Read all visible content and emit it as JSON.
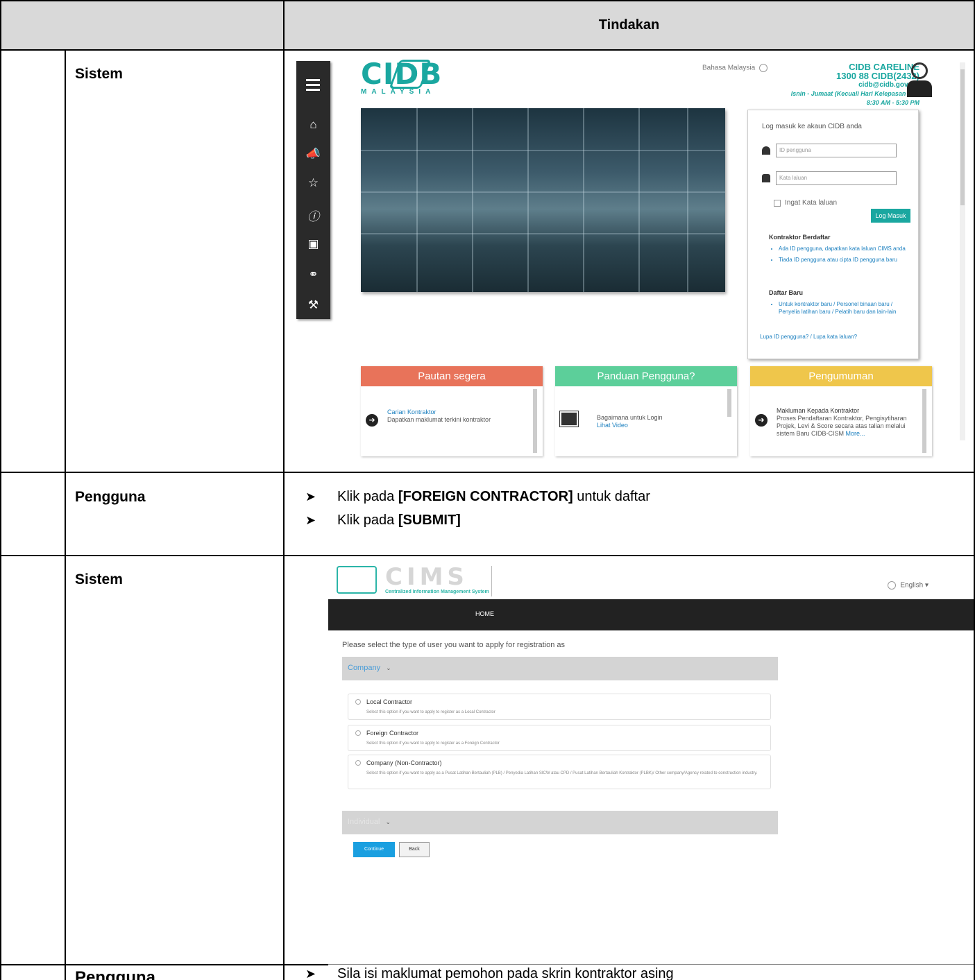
{
  "header": {
    "title": "Tindakan"
  },
  "rows": [
    {
      "actor": "Sistem"
    },
    {
      "actor": "Pengguna"
    },
    {
      "actor": "Sistem"
    },
    {
      "actor": "Pengguna"
    }
  ],
  "instructions_1": [
    {
      "pre": "Klik pada ",
      "bold": "[FOREIGN CONTRACTOR]",
      "post": " untuk daftar"
    },
    {
      "pre": "Klik pada ",
      "bold": "[SUBMIT]",
      "post": ""
    }
  ],
  "instructions_2": [
    {
      "pre": "Sila isi maklumat pemohon pada skrin kontraktor asing",
      "bold": "",
      "post": ""
    }
  ],
  "cidb_portal": {
    "logo_text": "CIDB",
    "logo_sub": "MALAYSIA",
    "language": "Bahasa Malaysia",
    "careline": {
      "title": "CIDB CARELINE",
      "phone": "1300 88 CIDB(2432)",
      "email": "cidb@cidb.gov.my",
      "days": "Isnin - Jumaat (Kecuali Hari Kelepasan Am)",
      "hours": "8:30 AM - 5:30 PM"
    },
    "sidebar_icons": [
      "menu-icon",
      "home-icon",
      "megaphone-icon",
      "calendar-star-icon",
      "info-icon",
      "gallery-icon",
      "network-icon",
      "tools-icon"
    ],
    "login": {
      "title": "Log masuk ke akaun CIDB anda",
      "user_placeholder": "ID pengguna",
      "pass_placeholder": "Kata laluan",
      "remember": "Ingat Kata laluan",
      "submit": "Log Masuk",
      "registered_heading": "Kontraktor Berdaftar",
      "registered_links": [
        "Ada ID pengguna, dapatkan kata laluan CIMS anda",
        "Tiada ID pengguna atau cipta ID pengguna baru"
      ],
      "new_heading": "Daftar Baru",
      "new_links": [
        "Untuk kontraktor baru / Personel binaan baru / Penyelia latihan baru / Pelatih baru dan lain-lain"
      ],
      "forgot": "Lupa ID pengguna? / Lupa kata laluan?"
    },
    "panels": [
      {
        "title": "Pautan segera",
        "color": "#e8735a",
        "link": "Carian Kontraktor",
        "text": "Dapatkan maklumat terkini kontraktor"
      },
      {
        "title": "Panduan Pengguna?",
        "color": "#5ccf9a",
        "link": "Bagaimana untuk Login",
        "text": "Lihat Video"
      },
      {
        "title": "Pengumuman",
        "color": "#efc64b",
        "link": "Makluman Kepada Kontraktor",
        "text": "Proses Pendaftaran Kontraktor, Pengisytiharan Projek, Levi & Score secara atas talian melalui sistem Baru CIDB-CISM",
        "more": "More..."
      }
    ]
  },
  "cims": {
    "logo_text": "CIMS",
    "logo_sub": "Centralized Information Management System",
    "language": "English",
    "nav_home": "HOME",
    "prompt": "Please select the type of user you want to apply for registration as",
    "section_company": "Company",
    "section_individual": "Individual",
    "options": [
      {
        "name": "Local Contractor",
        "desc": "Select this option if you want to apply to register as a Local Contractor"
      },
      {
        "name": "Foreign Contractor",
        "desc": "Select this option if you want to apply to register as a Foreign Contractor"
      },
      {
        "name": "Company (Non-Contractor)",
        "desc": "Select this option if you want to apply as a Pusat Latihan Bertauliah (PLB) / Penyedia Latihan SICW atau CPD / Pusat Latihan Bertauliah Kontraktor (PLBK)/ Other company/Agency related to construction industry."
      }
    ],
    "continue": "Continue",
    "back": "Back"
  }
}
